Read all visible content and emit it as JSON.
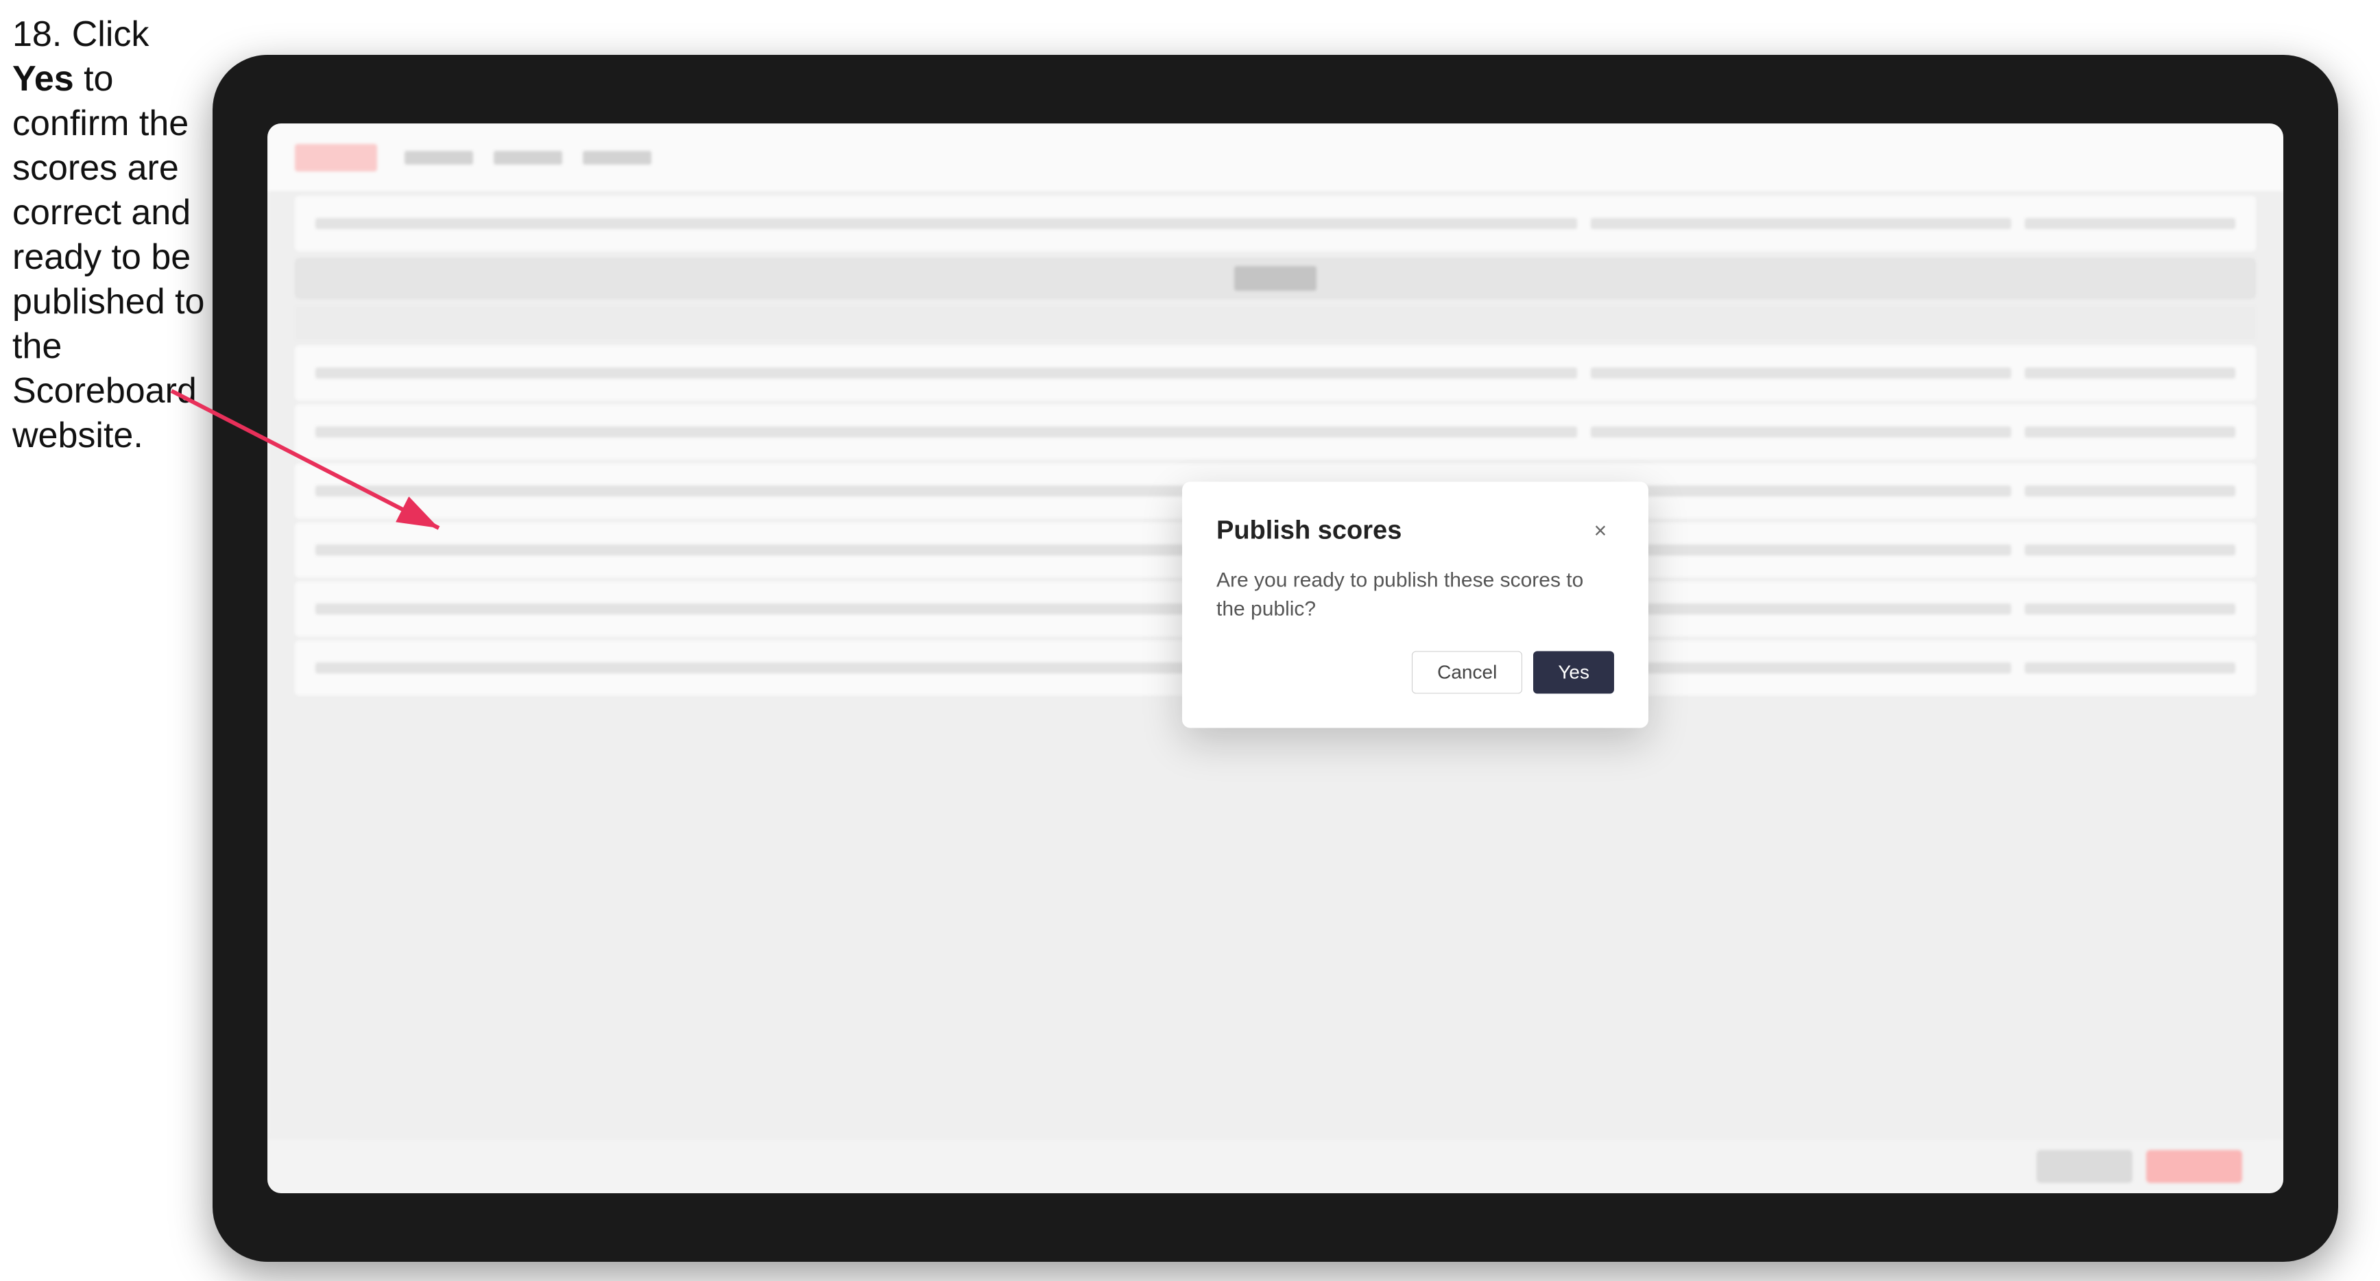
{
  "instruction": {
    "step": "18.",
    "text_part1": " Click ",
    "bold": "Yes",
    "text_part2": " to confirm the scores are correct and ready to be published to the Scoreboard website."
  },
  "tablet": {
    "screen": {
      "bg_rows": 7
    }
  },
  "dialog": {
    "title": "Publish scores",
    "body": "Are you ready to publish these scores to the public?",
    "cancel_label": "Cancel",
    "yes_label": "Yes",
    "close_icon": "×"
  }
}
